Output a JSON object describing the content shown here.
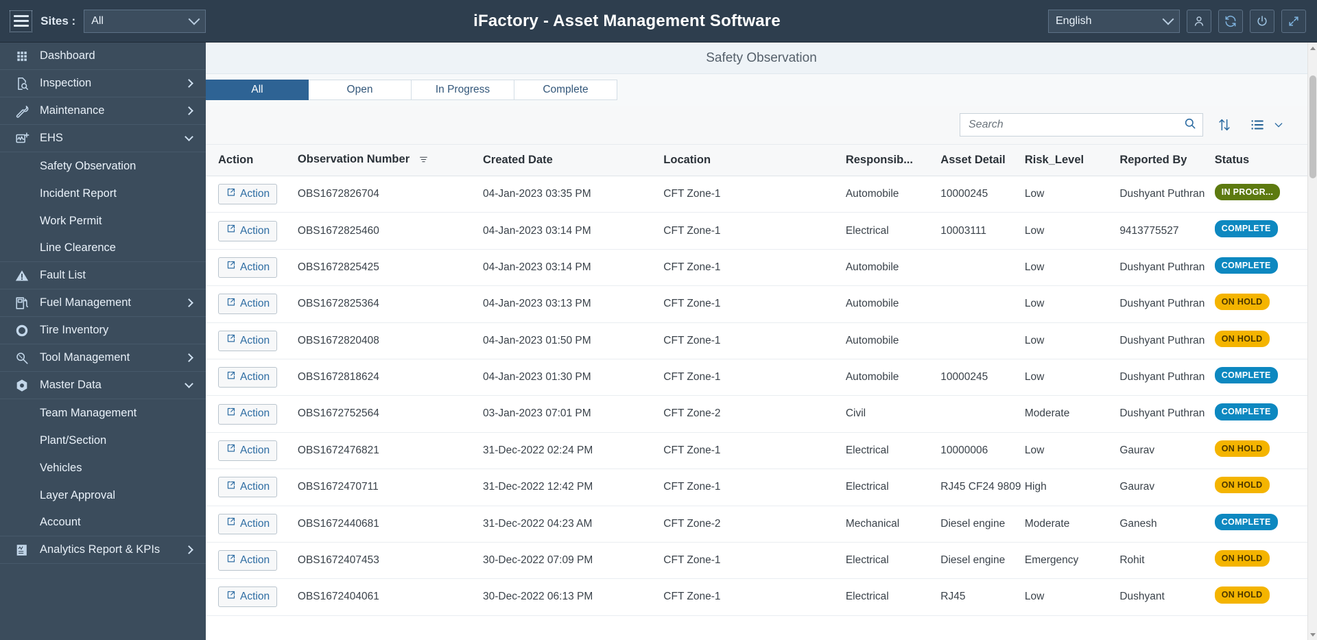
{
  "header": {
    "menu_icon": "hamburger-icon",
    "sites_label": "Sites :",
    "sites_value": "All",
    "app_title": "iFactory - Asset Management Software",
    "language_value": "English",
    "icons": [
      "user-icon",
      "refresh-icon",
      "power-icon",
      "fullscreen-icon"
    ]
  },
  "sidebar": {
    "items": [
      {
        "label": "Dashboard",
        "icon": "grid-icon",
        "expandable": false,
        "expanded": false,
        "sub": []
      },
      {
        "label": "Inspection",
        "icon": "document-search-icon",
        "expandable": true,
        "expanded": false,
        "sub": []
      },
      {
        "label": "Maintenance",
        "icon": "wrench-icon",
        "expandable": true,
        "expanded": false,
        "sub": []
      },
      {
        "label": "EHS",
        "icon": "health-chart-icon",
        "expandable": true,
        "expanded": true,
        "sub": [
          "Safety Observation",
          "Incident Report",
          "Work Permit",
          "Line Clearence"
        ]
      },
      {
        "label": "Fault List",
        "icon": "warning-icon",
        "expandable": false,
        "expanded": false,
        "sub": []
      },
      {
        "label": "Fuel Management",
        "icon": "fuel-pump-icon",
        "expandable": true,
        "expanded": false,
        "sub": []
      },
      {
        "label": "Tire Inventory",
        "icon": "tire-icon",
        "expandable": false,
        "expanded": false,
        "sub": []
      },
      {
        "label": "Tool Management",
        "icon": "tool-search-icon",
        "expandable": true,
        "expanded": false,
        "sub": []
      },
      {
        "label": "Master Data",
        "icon": "cube-icon",
        "expandable": true,
        "expanded": true,
        "sub": [
          "Team Management",
          "Plant/Section",
          "Vehicles",
          "Layer Approval",
          "Account"
        ]
      },
      {
        "label": "Analytics Report & KPIs",
        "icon": "report-chart-icon",
        "expandable": true,
        "expanded": false,
        "sub": []
      }
    ]
  },
  "page": {
    "title": "Safety Observation"
  },
  "tabs": [
    {
      "label": "All",
      "active": true
    },
    {
      "label": "Open",
      "active": false
    },
    {
      "label": "In Progress",
      "active": false
    },
    {
      "label": "Complete",
      "active": false
    }
  ],
  "toolbar": {
    "search_value": "",
    "search_placeholder": "Search",
    "search_icon": "magnifier-icon",
    "sort_icon": "sort-updown-icon",
    "view_icon": "list-view-icon",
    "view_chevron_icon": "chevron-down-icon"
  },
  "table": {
    "columns": [
      "Action",
      "Observation Number",
      "Created Date",
      "Location",
      "Responsib...",
      "Asset Detail",
      "Risk_Level",
      "Reported By",
      "Status"
    ],
    "action_label": "Action",
    "action_icon": "external-link-icon",
    "filter_icon": "filter-lines-icon",
    "rows": [
      {
        "observation_number": "OBS1672826704",
        "created_date": "04-Jan-2023 03:35 PM",
        "location": "CFT Zone-1",
        "responsible": "Automobile",
        "asset_detail": "10000245",
        "risk_level": "Low",
        "reported_by": "Dushyant Puthran",
        "status": "IN PROGR...",
        "status_kind": "inprogress"
      },
      {
        "observation_number": "OBS1672825460",
        "created_date": "04-Jan-2023 03:14 PM",
        "location": "CFT Zone-1",
        "responsible": "Electrical",
        "asset_detail": "10003111",
        "risk_level": "Low",
        "reported_by": "9413775527",
        "status": "COMPLETE",
        "status_kind": "complete"
      },
      {
        "observation_number": "OBS1672825425",
        "created_date": "04-Jan-2023 03:14 PM",
        "location": "CFT Zone-1",
        "responsible": "Automobile",
        "asset_detail": "",
        "risk_level": "Low",
        "reported_by": "Dushyant Puthran",
        "status": "COMPLETE",
        "status_kind": "complete"
      },
      {
        "observation_number": "OBS1672825364",
        "created_date": "04-Jan-2023 03:13 PM",
        "location": "CFT Zone-1",
        "responsible": "Automobile",
        "asset_detail": "",
        "risk_level": "Low",
        "reported_by": "Dushyant Puthran",
        "status": "ON HOLD",
        "status_kind": "onhold"
      },
      {
        "observation_number": "OBS1672820408",
        "created_date": "04-Jan-2023 01:50 PM",
        "location": "CFT Zone-1",
        "responsible": "Automobile",
        "asset_detail": "",
        "risk_level": "Low",
        "reported_by": "Dushyant Puthran",
        "status": "ON HOLD",
        "status_kind": "onhold"
      },
      {
        "observation_number": "OBS1672818624",
        "created_date": "04-Jan-2023 01:30 PM",
        "location": "CFT Zone-1",
        "responsible": "Automobile",
        "asset_detail": "10000245",
        "risk_level": "Low",
        "reported_by": "Dushyant Puthran",
        "status": "COMPLETE",
        "status_kind": "complete"
      },
      {
        "observation_number": "OBS1672752564",
        "created_date": "03-Jan-2023 07:01 PM",
        "location": "CFT Zone-2",
        "responsible": "Civil",
        "asset_detail": "",
        "risk_level": "Moderate",
        "reported_by": "Dushyant Puthran",
        "status": "COMPLETE",
        "status_kind": "complete"
      },
      {
        "observation_number": "OBS1672476821",
        "created_date": "31-Dec-2022 02:24 PM",
        "location": "CFT Zone-1",
        "responsible": "Electrical",
        "asset_detail": "10000006",
        "risk_level": "Low",
        "reported_by": "Gaurav",
        "status": "ON HOLD",
        "status_kind": "onhold"
      },
      {
        "observation_number": "OBS1672470711",
        "created_date": "31-Dec-2022 12:42 PM",
        "location": "CFT Zone-1",
        "responsible": "Electrical",
        "asset_detail": "RJ45 CF24 9809",
        "risk_level": "High",
        "reported_by": "Gaurav",
        "status": "ON HOLD",
        "status_kind": "onhold"
      },
      {
        "observation_number": "OBS1672440681",
        "created_date": "31-Dec-2022 04:23 AM",
        "location": "CFT Zone-2",
        "responsible": "Mechanical",
        "asset_detail": "Diesel engine",
        "risk_level": "Moderate",
        "reported_by": "Ganesh",
        "status": "COMPLETE",
        "status_kind": "complete"
      },
      {
        "observation_number": "OBS1672407453",
        "created_date": "30-Dec-2022 07:09 PM",
        "location": "CFT Zone-1",
        "responsible": "Electrical",
        "asset_detail": "Diesel engine",
        "risk_level": "Emergency",
        "reported_by": "Rohit",
        "status": "ON HOLD",
        "status_kind": "onhold"
      },
      {
        "observation_number": "OBS1672404061",
        "created_date": "30-Dec-2022 06:13 PM",
        "location": "CFT Zone-1",
        "responsible": "Electrical",
        "asset_detail": "RJ45",
        "risk_level": "Low",
        "reported_by": "Dushyant",
        "status": "ON HOLD",
        "status_kind": "onhold"
      }
    ]
  },
  "colors": {
    "header_bg": "#2e3e4e",
    "sidebar_bg": "#3b4c5c",
    "tab_active": "#2e6394",
    "status_complete": "#0d88c0",
    "status_onhold": "#f4b400",
    "status_inprogress": "#5d7a10"
  }
}
